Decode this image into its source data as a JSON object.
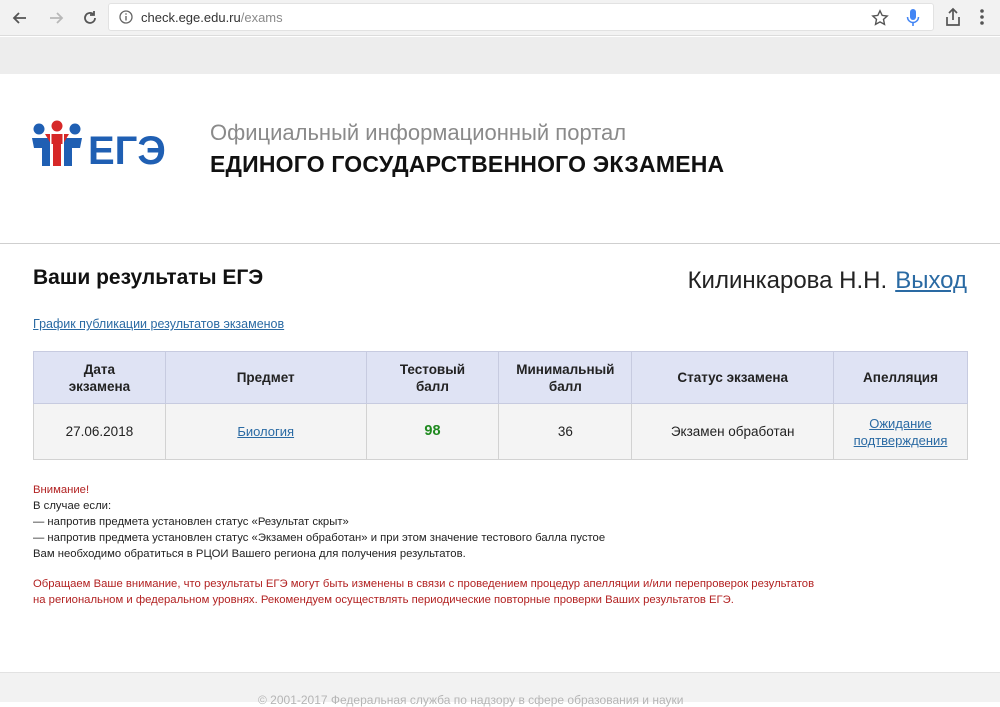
{
  "browser": {
    "url_host": "check.ege.edu.ru",
    "url_path": "/exams"
  },
  "header": {
    "logo_text": "ЕГЭ",
    "portal_line1": "Официальный информационный портал",
    "portal_line2": "ЕДИНОГО ГОСУДАРСТВЕННОГО ЭКЗАМЕНА"
  },
  "main": {
    "title": "Ваши результаты ЕГЭ",
    "user_name": "Килинкарова Н.Н.",
    "logout_label": "Выход",
    "schedule_link": "График публикации результатов экзаменов"
  },
  "table": {
    "headers": {
      "date": [
        "Дата",
        "экзамена"
      ],
      "subject": "Предмет",
      "score": [
        "Тестовый",
        "балл"
      ],
      "min_score": [
        "Минимальный",
        "балл"
      ],
      "status": "Статус экзамена",
      "appeal": "Апелляция"
    },
    "rows": [
      {
        "date": "27.06.2018",
        "subject": "Биология",
        "score": "98",
        "min_score": "36",
        "status": "Экзамен обработан",
        "appeal": [
          "Ожидание",
          "подтверждения"
        ]
      }
    ]
  },
  "notice": {
    "warning": "Внимание!",
    "line1": "В случае если:",
    "line2": "— напротив предмета установлен статус «Результат скрыт»",
    "line3": "— напротив предмета установлен статус «Экзамен обработан» и при этом значение тестового балла пустое",
    "line4": "Вам необходимо обратиться в РЦОИ Вашего региона для получения результатов."
  },
  "red_notice": {
    "line1": "Обращаем Ваше внимание, что результаты ЕГЭ могут быть изменены в связи с проведением процедур апелляции и/или перепроверок результатов",
    "line2": "на региональном и федеральном уровнях. Рекомендуем осуществлять периодические повторные проверки Ваших результатов ЕГЭ."
  },
  "footer": {
    "text": "© 2001-2017 Федеральная служба по надзору в сфере образования и науки"
  },
  "colors": {
    "link": "#2a6aa3",
    "score": "#1f8a1f",
    "warning": "#b22222",
    "table_header_bg": "#dfe3f4",
    "logo_blue": "#1f5fb3",
    "logo_red": "#d62828"
  },
  "icons": [
    "back-arrow-icon",
    "forward-arrow-icon",
    "reload-icon",
    "info-icon",
    "star-icon",
    "mic-icon",
    "share-icon",
    "menu-icon"
  ]
}
